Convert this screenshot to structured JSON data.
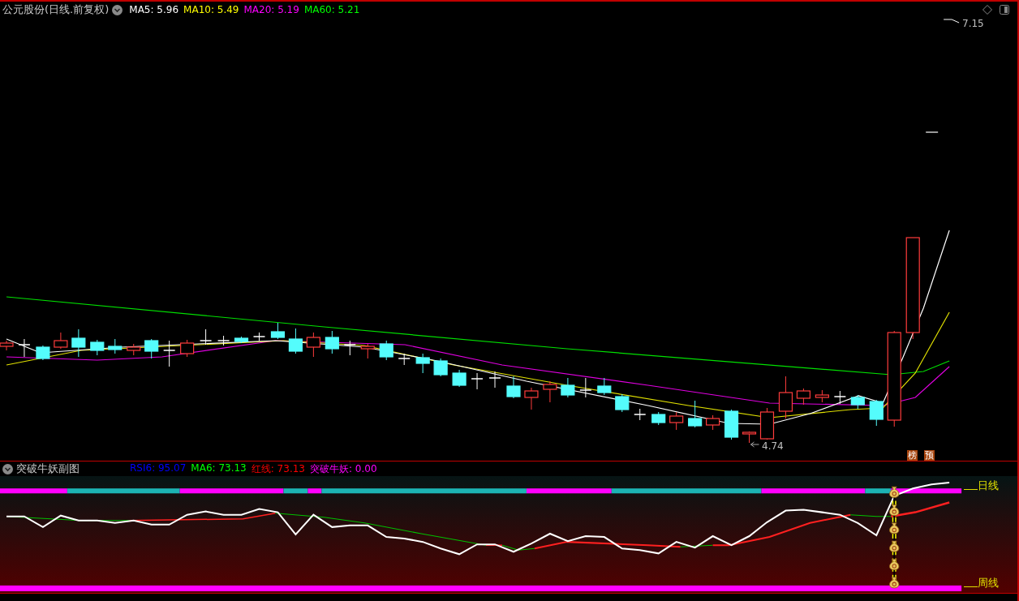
{
  "main_chart": {
    "title": "公元股份(日线.前复权)",
    "indicators": [
      {
        "label": "MA5: 5.96",
        "color": "#ffffff"
      },
      {
        "label": "MA10: 5.49",
        "color": "#ffff00"
      },
      {
        "label": "MA20: 5.19",
        "color": "#ff00ff"
      },
      {
        "label": "MA60: 5.21",
        "color": "#00ff00"
      }
    ],
    "high_label": "7.15",
    "low_label": "4.74",
    "badges": [
      "榜",
      "预"
    ]
  },
  "sub_chart": {
    "title": "突破牛妖副图",
    "indicators": [
      {
        "label": "RSI6: 95.07",
        "color": "#0000ff"
      },
      {
        "label": "MA6: 73.13",
        "color": "#00ff00"
      },
      {
        "label": "红线: 73.13",
        "color": "#ff0000"
      },
      {
        "label": "突破牛妖: 0.00",
        "color": "#ff00ff"
      }
    ],
    "line_labels": [
      "日线",
      "周线"
    ]
  }
}
